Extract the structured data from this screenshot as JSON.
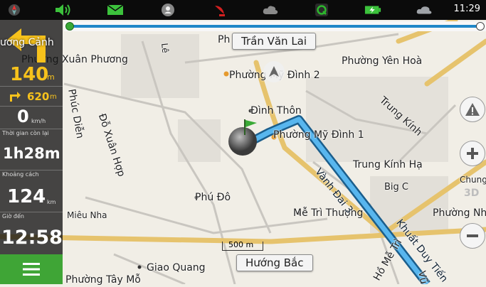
{
  "status_bar": {
    "time": "11:29",
    "icons": [
      "compass-icon",
      "volume-icon",
      "mail-icon",
      "user-location-icon",
      "satellite-dish-icon",
      "cloud-sync-icon",
      "app-q-icon",
      "battery-charging-icon",
      "weather-cloud-icon"
    ]
  },
  "route_progress": {
    "value": 0.02
  },
  "nav_panel": {
    "turn_street": "ương Cảnh",
    "turn_distance": "140",
    "turn_distance_unit": "m",
    "next_turn_distance": "620",
    "next_turn_unit": "m",
    "speed": "0",
    "speed_unit": "km/h",
    "time_left_label": "Thời gian còn lại",
    "time_left": "1h28m",
    "distance_label": "Khoảng cách",
    "distance": "124",
    "distance_unit": "km",
    "arrival_label": "Giờ đến",
    "arrival_time": "12:58"
  },
  "map": {
    "current_street": "Trần Văn Lai",
    "heading": "Hướng Bắc",
    "scale": "500 m",
    "labels": [
      "Phường Xuân Phương",
      "Phường Mỹ Đình 2",
      "Phường Yên Hoà",
      "Đình Thôn",
      "Phường Mỹ Đình 1",
      "Trung Kính",
      "Trung Kính Hạ",
      "Big C",
      "Phú Đô",
      "Mễ Trì Thượng",
      "Phường Nh",
      "Chung",
      "Miêu Nha",
      "Giao Quang",
      "Phường Tây Mỗ",
      "Đỗ Xuân Hợp",
      "Phúc Diễn",
      "Vành Đai 3",
      "Khuất Duy Tiến",
      "Hồ Mễ Trì",
      "Vũ",
      "Ph",
      "Lê"
    ],
    "badge_3d": "3D"
  },
  "map_controls": {
    "warning": "warning-icon",
    "zoom_in": "plus-icon",
    "zoom_out": "minus-icon"
  },
  "menu": {
    "icon": "hamburger-menu-icon"
  },
  "colors": {
    "route": "#2d9be0",
    "panel": "#141414",
    "menu_green": "#3fa536",
    "accent_yellow": "#f7c21c"
  }
}
